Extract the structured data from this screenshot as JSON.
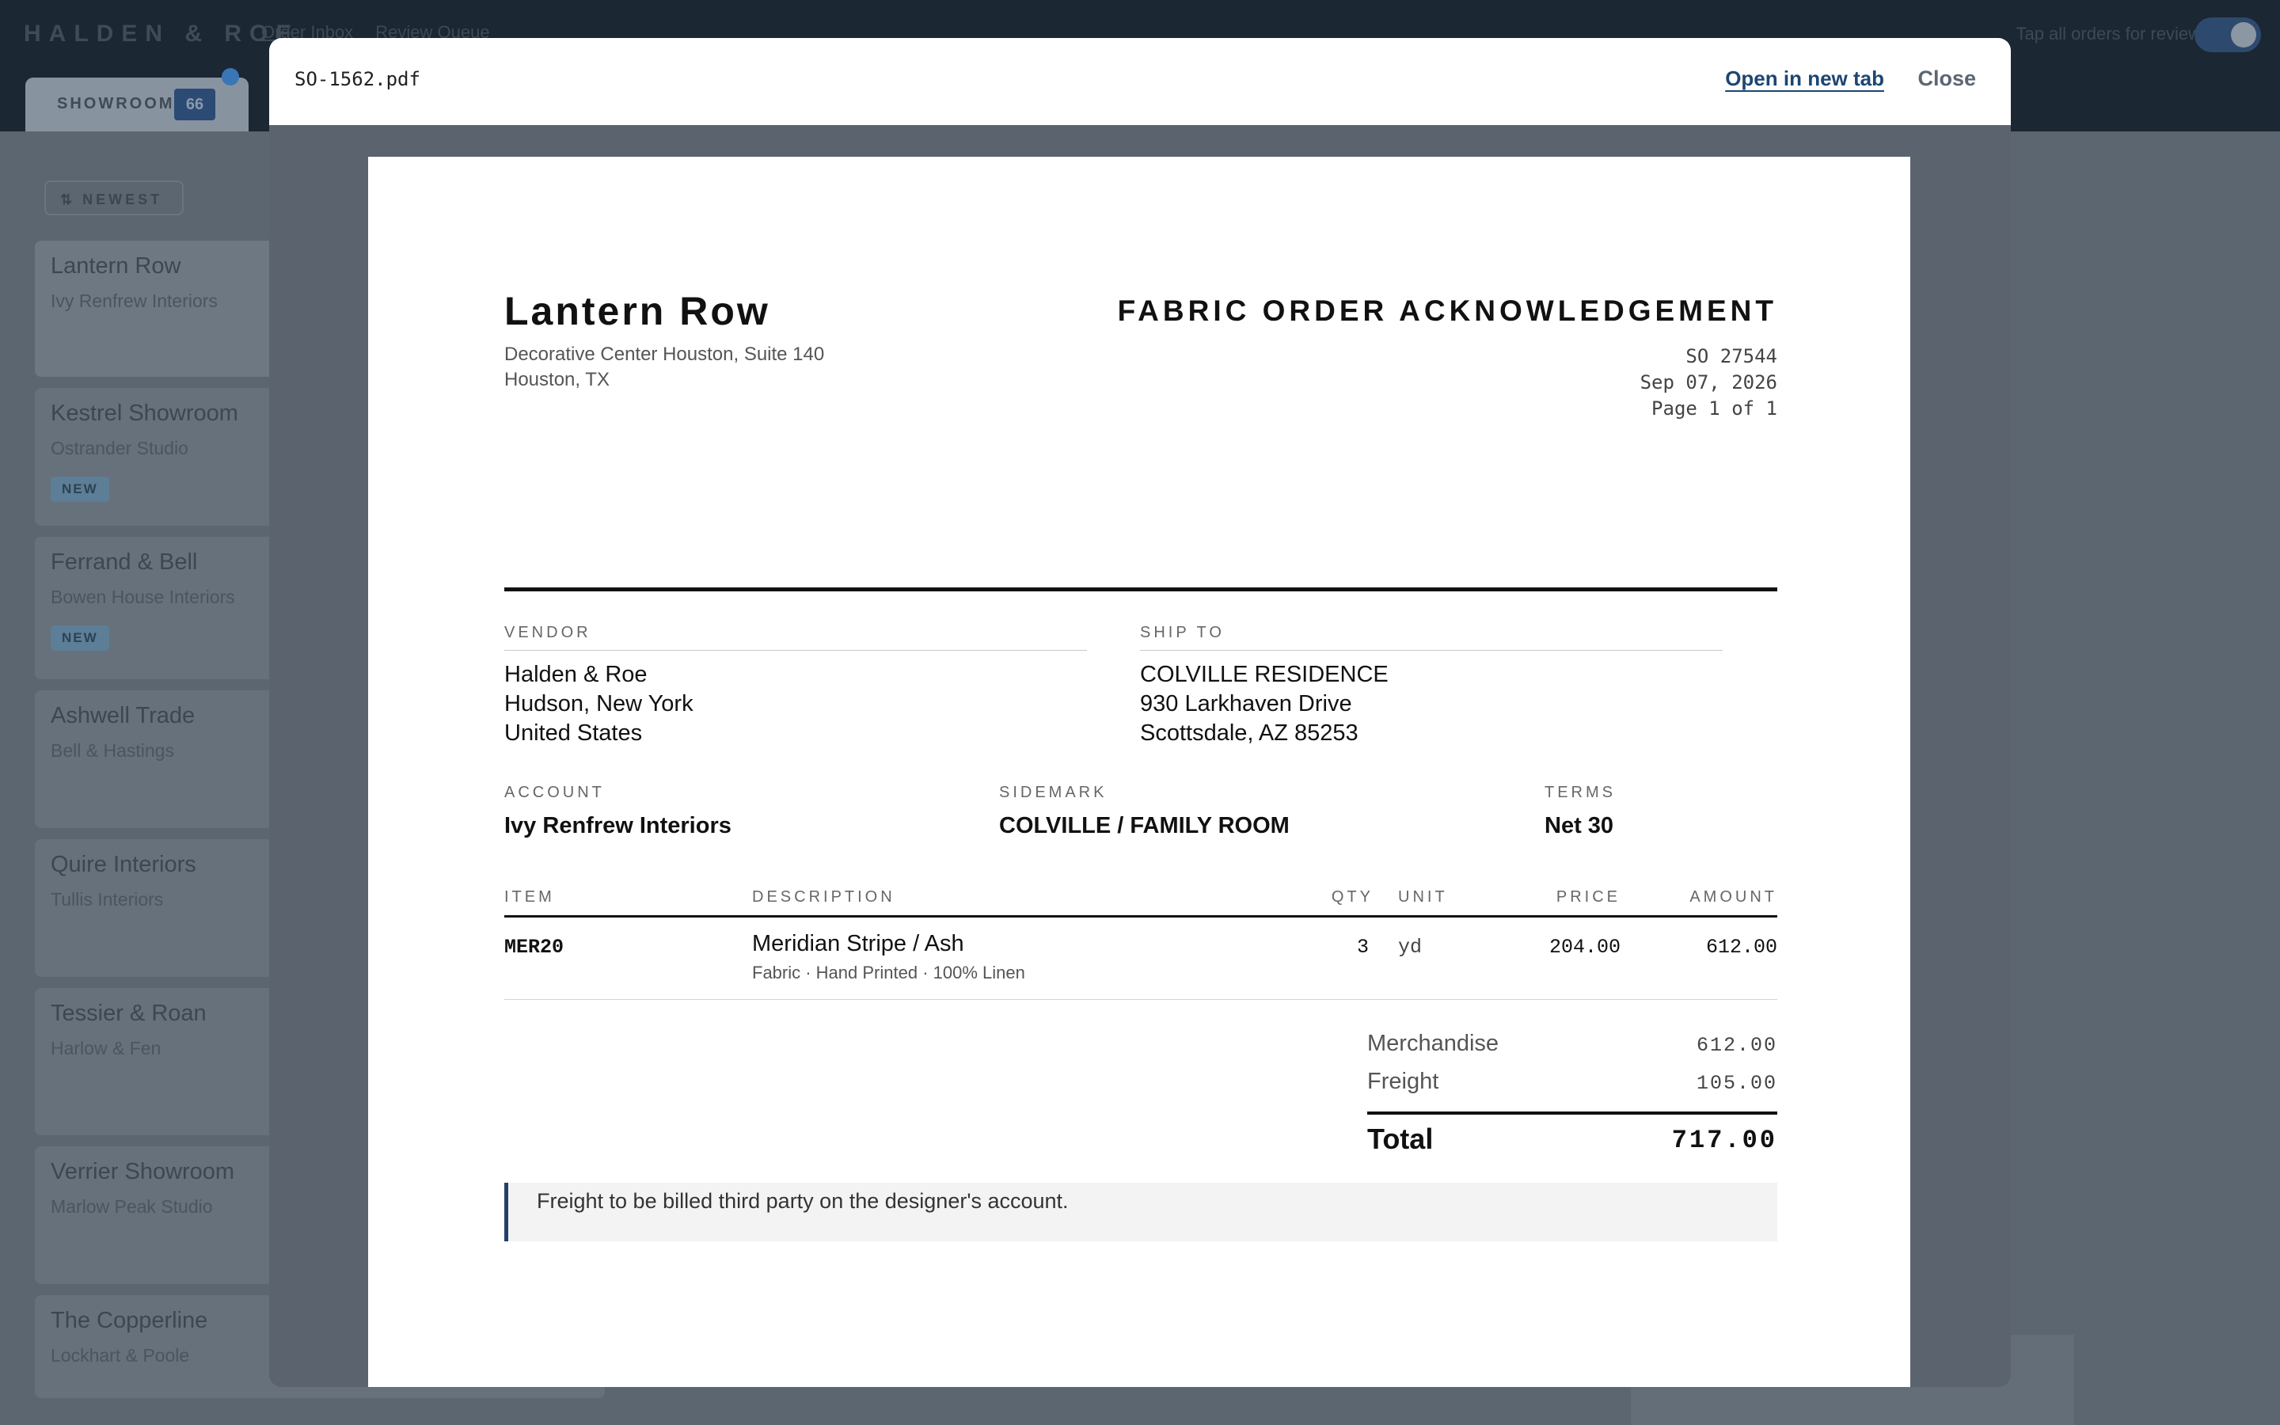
{
  "app": {
    "brand": "HALDEN & ROE",
    "nav": [
      "Order Inbox",
      "Review Queue"
    ],
    "toggle_label": "Tap all orders for review"
  },
  "tabs": [
    {
      "label": "SHOWROOM",
      "count": "66"
    }
  ],
  "list": {
    "sort_label": "⇅ NEWEST",
    "orders": [
      {
        "title": "Lantern Row",
        "subtitle": "Ivy Renfrew Interiors",
        "badge": ""
      },
      {
        "title": "Kestrel Showroom",
        "subtitle": "Ostrander Studio",
        "badge": "NEW"
      },
      {
        "title": "Ferrand & Bell",
        "subtitle": "Bowen House Interiors",
        "badge": "NEW"
      },
      {
        "title": "Ashwell Trade",
        "subtitle": "Bell & Hastings",
        "badge": ""
      },
      {
        "title": "Quire Interiors",
        "subtitle": "Tullis Interiors",
        "badge": ""
      },
      {
        "title": "Tessier & Roan",
        "subtitle": "Harlow & Fen",
        "badge": ""
      },
      {
        "title": "Verrier Showroom",
        "subtitle": "Marlow Peak Studio",
        "badge": ""
      },
      {
        "title": "The Copperline",
        "subtitle": "Lockhart & Poole",
        "badge": ""
      }
    ]
  },
  "modal": {
    "filename": "SO-1562.pdf",
    "open_label": "Open in new tab",
    "close_label": "Close"
  },
  "document": {
    "shop_name": "Lantern Row",
    "shop_address": [
      "Decorative Center Houston, Suite 140",
      "Houston, TX"
    ],
    "title": "FABRIC ORDER ACKNOWLEDGEMENT",
    "so_number": "SO 27544",
    "date": "Sep 07, 2026",
    "page": "Page 1 of 1",
    "vendor_label": "VENDOR",
    "vendor": [
      "Halden & Roe",
      "Hudson, New York",
      "United States"
    ],
    "shipto_label": "SHIP TO",
    "shipto": [
      "COLVILLE RESIDENCE",
      "930 Larkhaven Drive",
      "Scottsdale, AZ 85253"
    ],
    "account_label": "ACCOUNT",
    "account": "Ivy Renfrew Interiors",
    "sidemark_label": "SIDEMARK",
    "sidemark": "COLVILLE / FAMILY ROOM",
    "terms_label": "TERMS",
    "terms": "Net 30",
    "columns": {
      "item": "ITEM",
      "description": "DESCRIPTION",
      "qty": "QTY",
      "unit": "UNIT",
      "price": "PRICE",
      "amount": "AMOUNT"
    },
    "line": {
      "item": "MER20",
      "description": "Meridian Stripe / Ash",
      "detail": "Fabric · Hand Printed · 100% Linen",
      "qty": "3",
      "unit": "yd",
      "price": "204.00",
      "amount": "612.00"
    },
    "merch_label": "Merchandise",
    "merch_value": "612.00",
    "freight_label": "Freight",
    "freight_value": "105.00",
    "total_label": "Total",
    "total_value": "717.00",
    "note": "Freight to be billed third party on the designer's account."
  }
}
